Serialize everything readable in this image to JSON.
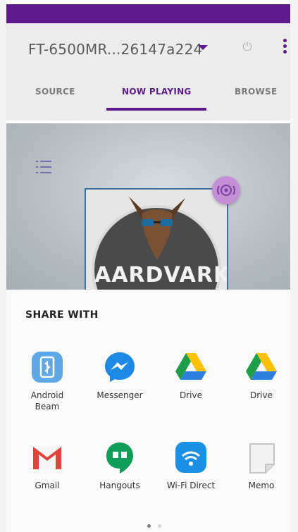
{
  "app": {
    "device_name": "FT-6500MR...26147a224",
    "colors": {
      "accent": "#5f1b8c",
      "status_bar": "#5f1b8c"
    }
  },
  "tabs": [
    {
      "label": "SOURCE",
      "active": false
    },
    {
      "label": "NOW PLAYING",
      "active": true
    },
    {
      "label": "BROWSE",
      "active": false
    }
  ],
  "now_playing": {
    "album_art_text": "AARDVARK"
  },
  "share_sheet": {
    "title": "SHARE WITH",
    "apps": [
      {
        "label": "Android\nBeam",
        "icon": "android-beam-icon"
      },
      {
        "label": "Messenger",
        "icon": "messenger-icon"
      },
      {
        "label": "Drive",
        "icon": "drive-icon"
      },
      {
        "label": "Drive",
        "icon": "drive-icon"
      },
      {
        "label": "Gmail",
        "icon": "gmail-icon"
      },
      {
        "label": "Hangouts",
        "icon": "hangouts-icon"
      },
      {
        "label": "Wi-Fi Direct",
        "icon": "wifi-direct-icon"
      },
      {
        "label": "Memo",
        "icon": "memo-icon"
      }
    ],
    "page_count": 2,
    "current_page": 1
  }
}
